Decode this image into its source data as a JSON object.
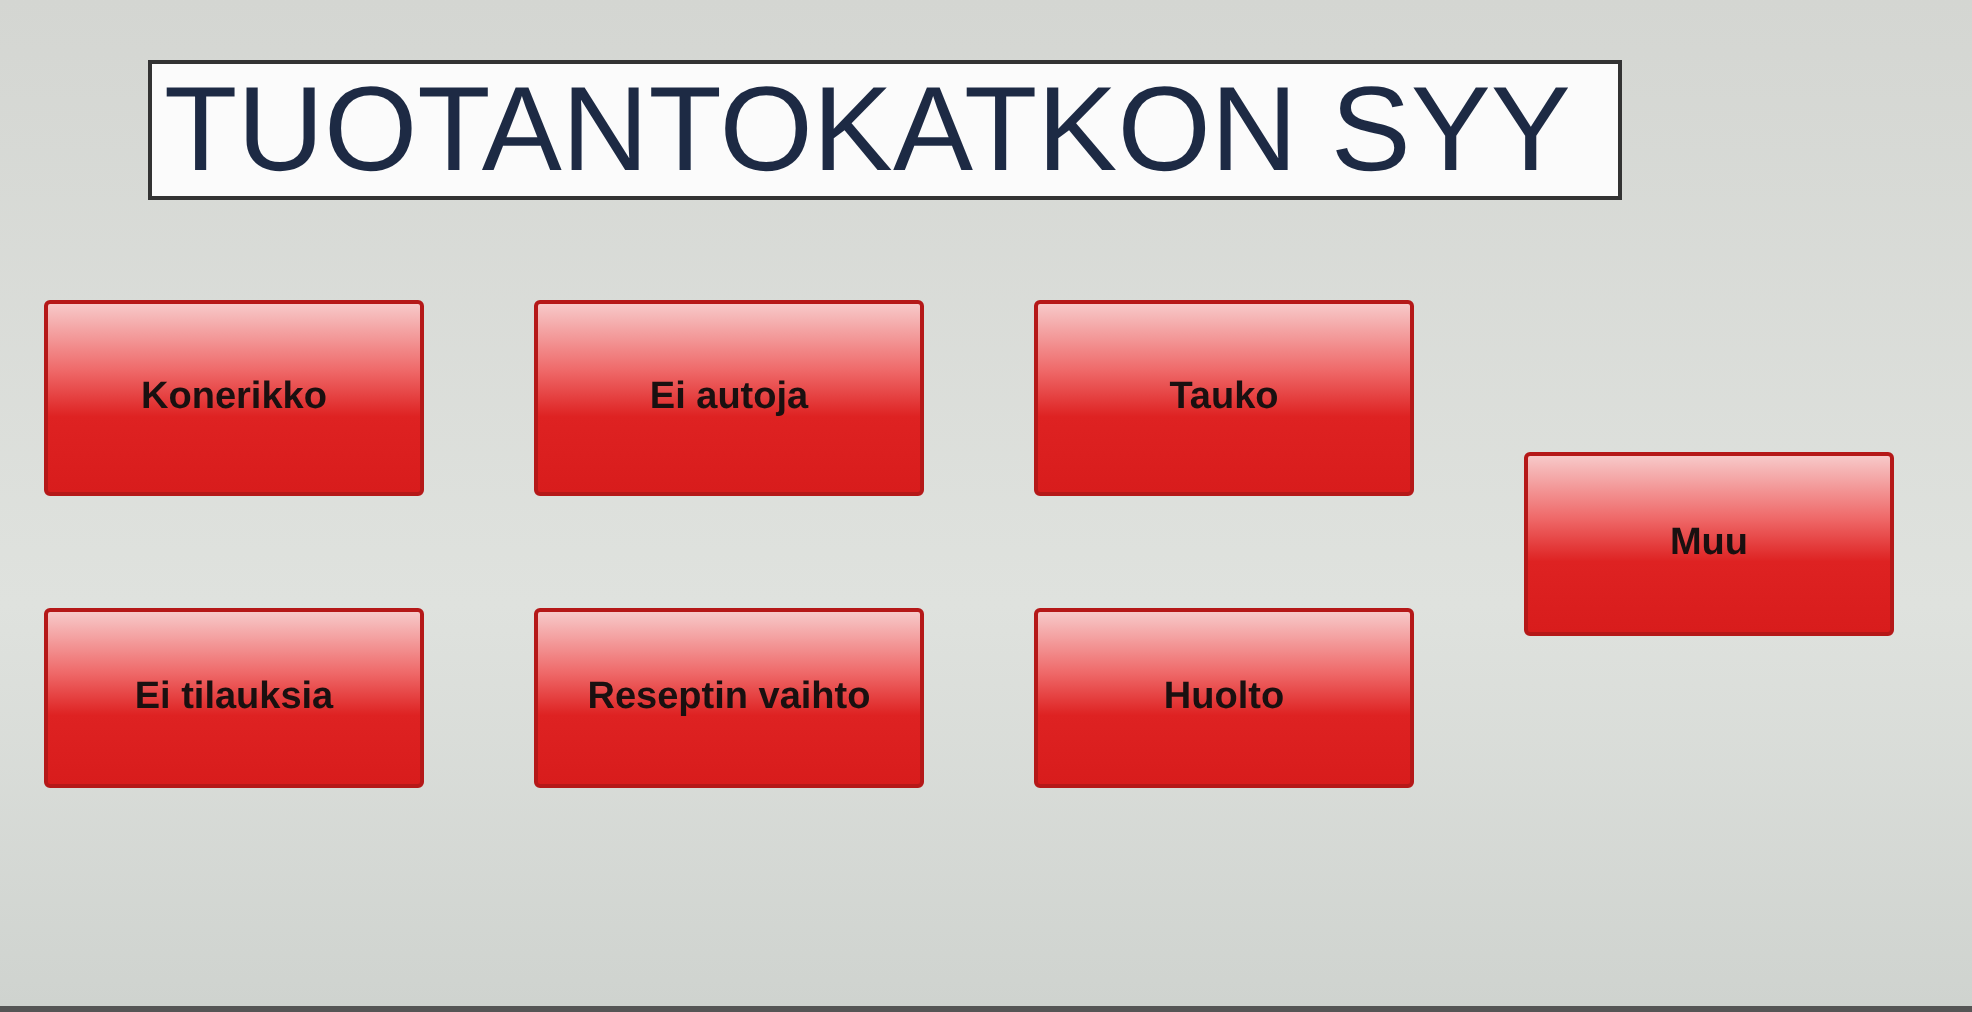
{
  "title": "TUOTANTOKATKON SYY",
  "buttons": [
    {
      "label": "Konerikko"
    },
    {
      "label": "Ei autoja"
    },
    {
      "label": "Tauko"
    },
    {
      "label": "Ei tilauksia"
    },
    {
      "label": "Reseptin vaihto"
    },
    {
      "label": "Huolto"
    },
    {
      "label": "Muu"
    }
  ]
}
